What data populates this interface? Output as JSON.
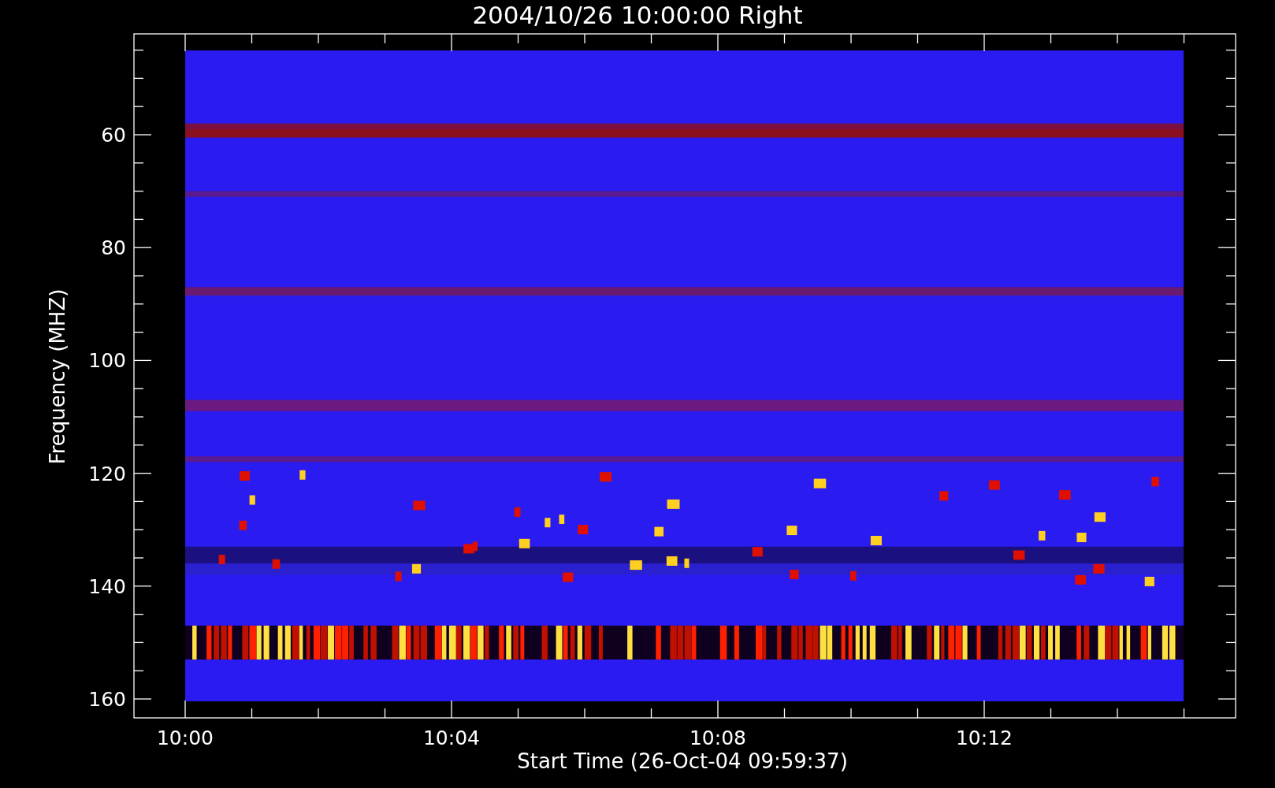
{
  "title": "2004/10/26 10:00:00 Right",
  "y_axis": {
    "label": "Frequency (MHZ)",
    "ticks": [
      "60",
      "80",
      "100",
      "120",
      "140",
      "160"
    ]
  },
  "x_axis": {
    "label": "Start Time (26-Oct-04 09:59:37)",
    "ticks": [
      "10:00",
      "10:04",
      "10:08",
      "10:12"
    ]
  }
}
